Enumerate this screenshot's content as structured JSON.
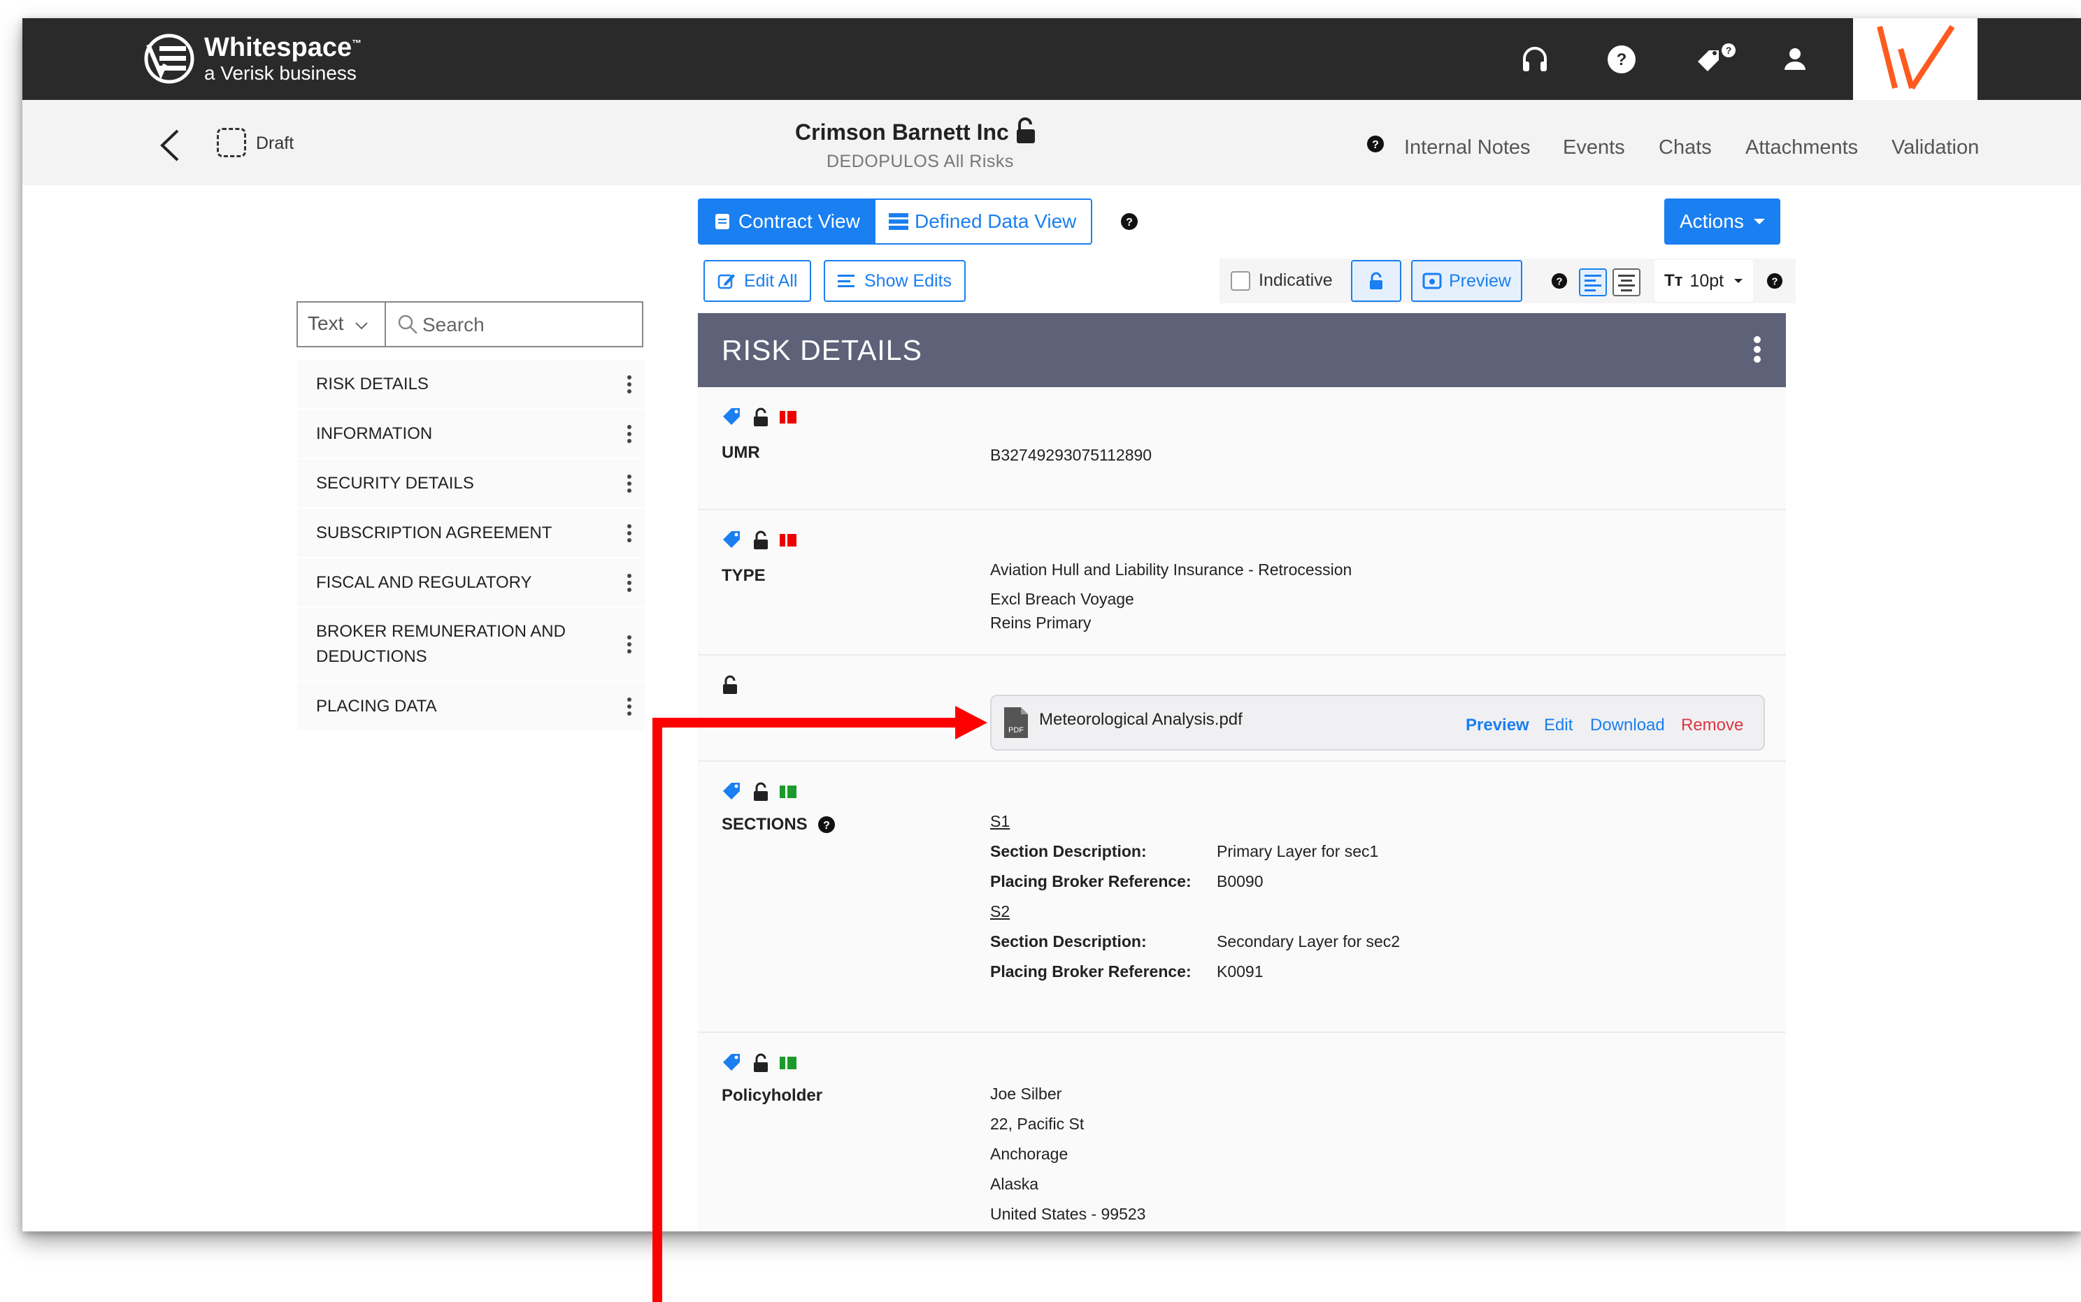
{
  "header": {
    "logo_title": "Whitespace",
    "logo_tm": "™",
    "logo_subtitle": "a Verisk business"
  },
  "subheader": {
    "status": "Draft",
    "title": "Crimson Barnett Inc",
    "subtitle": "DEDOPULOS All Risks",
    "nav": [
      "Internal Notes",
      "Events",
      "Chats",
      "Attachments",
      "Validation"
    ]
  },
  "views": {
    "contract_view": "Contract View",
    "defined_data_view": "Defined Data View",
    "actions": "Actions"
  },
  "toolbar": {
    "edit_all": "Edit All",
    "show_edits": "Show Edits",
    "indicative": "Indicative",
    "preview": "Preview",
    "font_size": "10pt"
  },
  "sidebar": {
    "filter_type": "Text",
    "search_placeholder": "Search",
    "items": [
      "RISK DETAILS",
      "INFORMATION",
      "SECURITY DETAILS",
      "SUBSCRIPTION AGREEMENT",
      "FISCAL AND REGULATORY",
      "BROKER REMUNERATION AND DEDUCTIONS",
      "PLACING DATA"
    ]
  },
  "document": {
    "section_title": "RISK DETAILS",
    "umr": {
      "label": "UMR",
      "value": "B32749293075112890"
    },
    "type": {
      "label": "TYPE",
      "values": [
        "Aviation Hull and Liability Insurance - Retrocession",
        "Excl Breach Voyage",
        "Reins Primary"
      ]
    },
    "attachment": {
      "filename": "Meteorological Analysis.pdf",
      "file_icon_text": "PDF",
      "actions": [
        "Preview",
        "Edit",
        "Download",
        "Remove"
      ]
    },
    "sections": {
      "label": "SECTIONS",
      "s1": {
        "id": "S1",
        "desc_label": "Section Description:",
        "desc_value": "Primary Layer for sec1",
        "ref_label": "Placing Broker Reference:",
        "ref_value": "B0090"
      },
      "s2": {
        "id": "S2",
        "desc_label": "Section Description:",
        "desc_value": "Secondary Layer for sec2",
        "ref_label": "Placing Broker Reference:",
        "ref_value": "K0091"
      }
    },
    "policyholder": {
      "label": "Policyholder",
      "lines": [
        "Joe Silber",
        "22, Pacific St",
        "Anchorage",
        "Alaska",
        "United States - 99523"
      ]
    }
  },
  "colors": {
    "topbar": "#2a2a2a",
    "primary": "#1a7ff0",
    "section_header": "#5d6279",
    "remove": "#dc3545",
    "annotation_arrow": "#ff0000",
    "brand_orange": "#ff5a1f"
  }
}
